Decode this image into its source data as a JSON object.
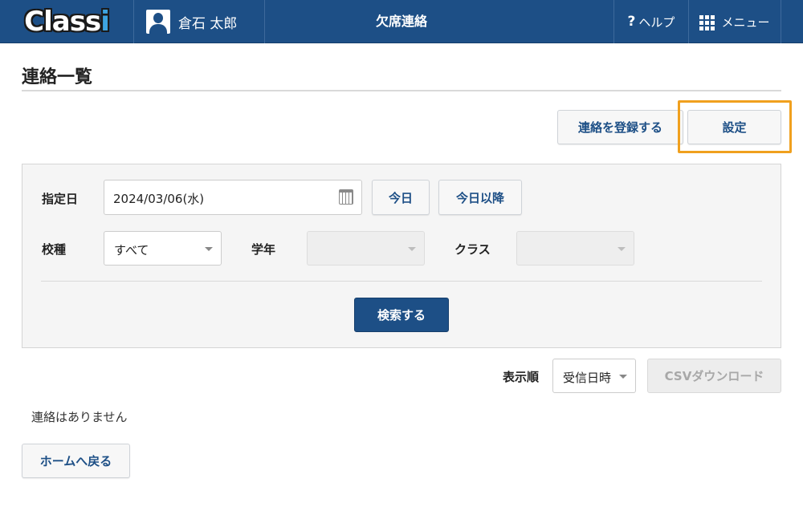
{
  "header": {
    "logo": "Classi",
    "user_name": "倉石 太郎",
    "page_name": "欠席連絡",
    "help_label": "ヘルプ",
    "help_icon": "?",
    "menu_label": "メニュー"
  },
  "page": {
    "title": "連絡一覧"
  },
  "actions": {
    "register_label": "連絡を登録する",
    "settings_label": "設定"
  },
  "search": {
    "date_label": "指定日",
    "date_value": "2024/03/06(水)",
    "today_label": "今日",
    "after_today_label": "今日以降",
    "school_type_label": "校種",
    "school_type_value": "すべて",
    "grade_label": "学年",
    "class_label": "クラス",
    "submit_label": "検索する"
  },
  "sort": {
    "label": "表示順",
    "value": "受信日時",
    "csv_label": "CSVダウンロード"
  },
  "result": {
    "empty_message": "連絡はありません"
  },
  "footer": {
    "home_label": "ホームへ戻る"
  },
  "colors": {
    "header_bg": "#1d4f86",
    "accent": "#1d4f86",
    "highlight": "#f0a01e"
  }
}
